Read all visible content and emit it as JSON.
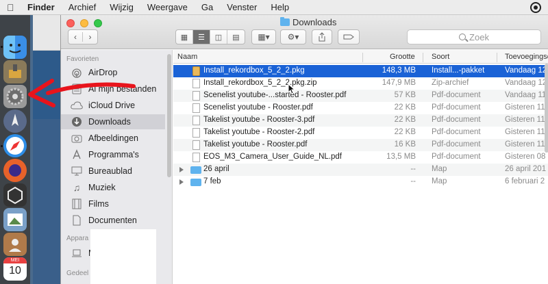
{
  "menubar": {
    "app": "Finder",
    "items": [
      "Archief",
      "Wijzig",
      "Weergave",
      "Ga",
      "Venster",
      "Help"
    ]
  },
  "window": {
    "title": "Downloads",
    "search_placeholder": "Zoek"
  },
  "sidebar": {
    "sections": [
      {
        "label": "Favorieten"
      },
      {
        "label": "Appara"
      },
      {
        "label": "Gedeel"
      }
    ],
    "items": [
      {
        "label": "AirDrop",
        "icon": "airdrop-icon"
      },
      {
        "label": "Al mijn bestanden",
        "icon": "all-files-icon"
      },
      {
        "label": "iCloud Drive",
        "icon": "cloud-icon"
      },
      {
        "label": "Downloads",
        "icon": "download-icon"
      },
      {
        "label": "Afbeeldingen",
        "icon": "camera-icon"
      },
      {
        "label": "Programma's",
        "icon": "apps-icon"
      },
      {
        "label": "Bureaublad",
        "icon": "desktop-icon"
      },
      {
        "label": "Muziek",
        "icon": "music-icon"
      },
      {
        "label": "Films",
        "icon": "film-icon"
      },
      {
        "label": "Documenten",
        "icon": "document-icon"
      },
      {
        "label": "M",
        "icon": "laptop-icon"
      }
    ]
  },
  "columns": {
    "name": "Naam",
    "size": "Grootte",
    "kind": "Soort",
    "date": "Toevoegingsd"
  },
  "files": [
    {
      "name": "Install_rekordbox_5_2_2.pkg",
      "size": "148,3 MB",
      "kind": "Install...-pakket",
      "date": "Vandaag 12:",
      "icon": "package-icon"
    },
    {
      "name": "Install_rekordbox_5_2_2.pkg.zip",
      "size": "147,9 MB",
      "kind": "Zip-archief",
      "date": "Vandaag 12:",
      "icon": "zip-icon"
    },
    {
      "name": "Scenelist youtube-...started - Rooster.pdf",
      "size": "57 KB",
      "kind": "Pdf-document",
      "date": "Vandaag 11:",
      "icon": "pdf-icon"
    },
    {
      "name": "Scenelist youtube - Rooster.pdf",
      "size": "22 KB",
      "kind": "Pdf-document",
      "date": "Gisteren 11:",
      "icon": "pdf-icon"
    },
    {
      "name": "Takelist youtube - Rooster-3.pdf",
      "size": "22 KB",
      "kind": "Pdf-document",
      "date": "Gisteren 11:",
      "icon": "pdf-icon"
    },
    {
      "name": "Takelist youtube - Rooster-2.pdf",
      "size": "22 KB",
      "kind": "Pdf-document",
      "date": "Gisteren 11:",
      "icon": "pdf-icon"
    },
    {
      "name": "Takelist youtube - Rooster.pdf",
      "size": "16 KB",
      "kind": "Pdf-document",
      "date": "Gisteren 11:",
      "icon": "pdf-icon"
    },
    {
      "name": "EOS_M3_Camera_User_Guide_NL.pdf",
      "size": "13,5 MB",
      "kind": "Pdf-document",
      "date": "Gisteren 08",
      "icon": "pdf-icon"
    },
    {
      "name": "26 april",
      "size": "--",
      "kind": "Map",
      "date": "26 april 201",
      "icon": "folder-icon"
    },
    {
      "name": "7 feb",
      "size": "--",
      "kind": "Map",
      "date": "6 februari 2",
      "icon": "folder-icon"
    }
  ],
  "dock": {
    "calendar_month": "MEI",
    "calendar_day": "10"
  },
  "colors": {
    "selection": "#1a62d6",
    "annotation_arrow": "#e8141c",
    "folder": "#5fb3ee"
  }
}
